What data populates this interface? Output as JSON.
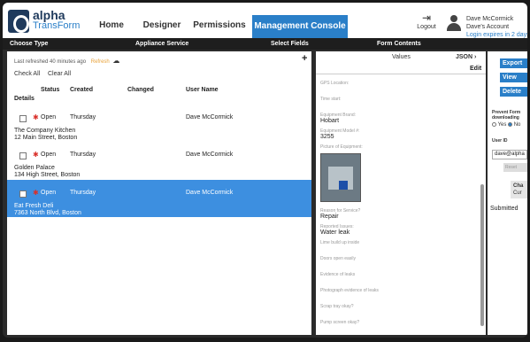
{
  "brand": {
    "line1": "alpha",
    "line2": "TransForm"
  },
  "nav": [
    "Home",
    "Designer",
    "Permissions",
    "Management Console"
  ],
  "logout": "Logout",
  "user": {
    "name": "Dave McCormick",
    "account": "Dave's Account",
    "expiry": "Login expires in 2 days"
  },
  "headers": {
    "choose_type": "Choose Type",
    "appliance": "Appliance Service",
    "select_fields": "Select Fields",
    "form_contents": "Form Contents"
  },
  "list": {
    "refreshed": "Last refreshed 40 minutes ago",
    "refresh_link": "Refresh",
    "add": "+",
    "check_all": "Check All",
    "clear_all": "Clear All",
    "columns": [
      "Status",
      "Created",
      "Changed",
      "User Name"
    ],
    "details": "Details",
    "rows": [
      {
        "status": "Open",
        "created": "Thursday",
        "changed": "",
        "user": "Dave McCormick",
        "name": "The Company Kitchen",
        "address": "12 Main Street, Boston"
      },
      {
        "status": "Open",
        "created": "Thursday",
        "changed": "",
        "user": "Dave McCormick",
        "name": "Golden Palace",
        "address": "134 High Street, Boston"
      },
      {
        "status": "Open",
        "created": "Thursday",
        "changed": "",
        "user": "Dave McCormick",
        "name": "Eat Fresh Deli",
        "address": "7363 North Blvd, Boston"
      }
    ]
  },
  "form": {
    "values": "Values",
    "json": "JSON",
    "edit": "Edit",
    "gps": "GPS Location:",
    "time_start": "Time start:",
    "brand_label": "Equipment Brand:",
    "brand_value": "Hobart",
    "model_label": "Equipment Model #:",
    "model_value": "3255",
    "picture_label": "Picture of Equipment:",
    "reason_label": "Reason for Service?",
    "reason_value": "Repair",
    "issue_label": "Reported Issues:",
    "issue_value": "Water leak",
    "q1": "Lime build up inside",
    "q2": "Doors open easily",
    "q3": "Evidence of leaks",
    "q4": "Photograph evidence of leaks",
    "q5": "Scrap tray okay?",
    "q6": "Pump screen okay?"
  },
  "right": {
    "export": "Export",
    "view": "View",
    "delete": "Delete",
    "prevent1": "Prevent Form",
    "prevent2": "downloading",
    "yes": "Yes",
    "no": "No",
    "user_id": "User ID",
    "user_id_value": "dave@alpha",
    "reset": "Reset",
    "change": "Cha",
    "current": "Cur",
    "submitted": "Submitted"
  },
  "colors": {
    "accent": "#2a7fc8",
    "selected_row": "#3d8fe0",
    "required": "#d9302a",
    "refresh": "#e8a23a"
  }
}
